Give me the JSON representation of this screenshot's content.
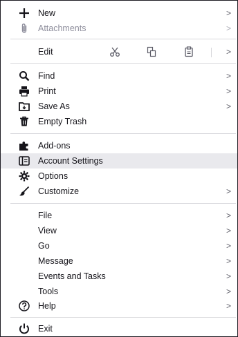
{
  "menu": {
    "items": {
      "new": {
        "label": "New",
        "icon": "plus-icon"
      },
      "attachments": {
        "label": "Attachments",
        "icon": "paperclip-icon"
      },
      "edit": {
        "label": "Edit"
      },
      "find": {
        "label": "Find",
        "icon": "search-icon"
      },
      "print": {
        "label": "Print",
        "icon": "printer-icon"
      },
      "save_as": {
        "label": "Save As",
        "icon": "save-as-icon"
      },
      "empty_trash": {
        "label": "Empty Trash",
        "icon": "trash-icon"
      },
      "add_ons": {
        "label": "Add-ons",
        "icon": "puzzle-icon"
      },
      "account_settings": {
        "label": "Account Settings",
        "icon": "account-icon"
      },
      "options": {
        "label": "Options",
        "icon": "gear-icon"
      },
      "customize": {
        "label": "Customize",
        "icon": "brush-icon"
      },
      "file": {
        "label": "File"
      },
      "view": {
        "label": "View"
      },
      "go": {
        "label": "Go"
      },
      "message": {
        "label": "Message"
      },
      "events_and_tasks": {
        "label": "Events and Tasks"
      },
      "tools": {
        "label": "Tools"
      },
      "help": {
        "label": "Help",
        "icon": "help-icon"
      },
      "exit": {
        "label": "Exit",
        "icon": "power-icon"
      }
    },
    "submenu_arrow": ">",
    "highlighted_item": "Account Settings"
  }
}
